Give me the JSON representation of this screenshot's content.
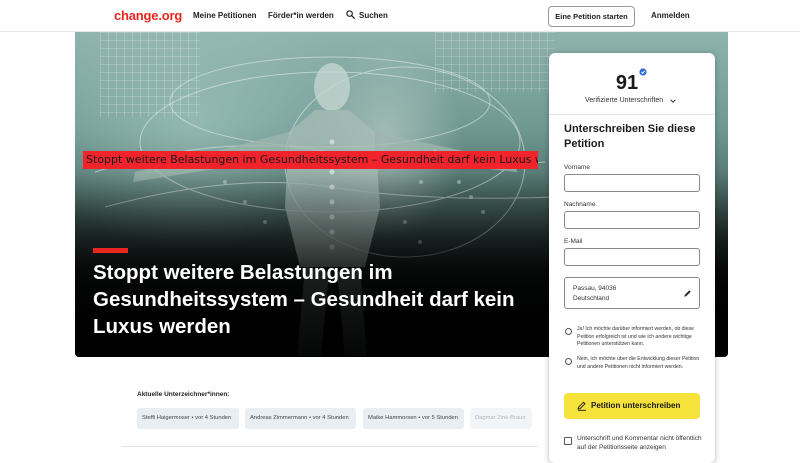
{
  "nav": {
    "logo": "change.org",
    "my_petitions": "Meine Petitionen",
    "supporters": "Förder*in werden",
    "search": "Suchen",
    "start_petition": "Eine Petition starten",
    "login": "Anmelden"
  },
  "hero": {
    "banner_text": "Stoppt weitere Belastungen im Gesundheitssystem – Gesundheit darf kein Luxus werden",
    "title": "Stoppt weitere Belastungen im Gesundheitssystem – Gesundheit darf kein Luxus werden"
  },
  "sign": {
    "count": "91",
    "verified_label": "Verifizierte Unterschriften",
    "title": "Unterschreiben Sie diese Petition",
    "first_name_label": "Vorname",
    "last_name_label": "Nachname",
    "email_label": "E-Mail",
    "address_line1": "Passau, 94036",
    "address_line2": "Deutschland",
    "opt_in": "Ja! Ich möchte darüber informiert werden, ob diese Petition erfolgreich ist und wie ich andere wichtige Petitionen unterstützen kann.",
    "opt_out": "Nein, ich möchte über die Entwicklung dieser Petition und andere Petitionen nicht informiert werden.",
    "submit": "Petition unterschreiben",
    "hide_checkbox": "Unterschrift und Kommentar nicht öffentlich auf der Petitionsseite anzeigen"
  },
  "signers": {
    "label": "Aktuelle Unterzeichner*innen:",
    "items": [
      "Steffi Haigermoser • vor 4 Stunden",
      "Andreas Zimmermann • vor 4 Stunden",
      "Maike Hammorsen • vor 5 Stunden",
      "Dagmar Zink-Braun"
    ]
  },
  "colors": {
    "brand_red": "#e8261d",
    "banner_red": "#f2232b",
    "submit_yellow": "#f5e23b",
    "verified_blue": "#2f6fe0"
  }
}
